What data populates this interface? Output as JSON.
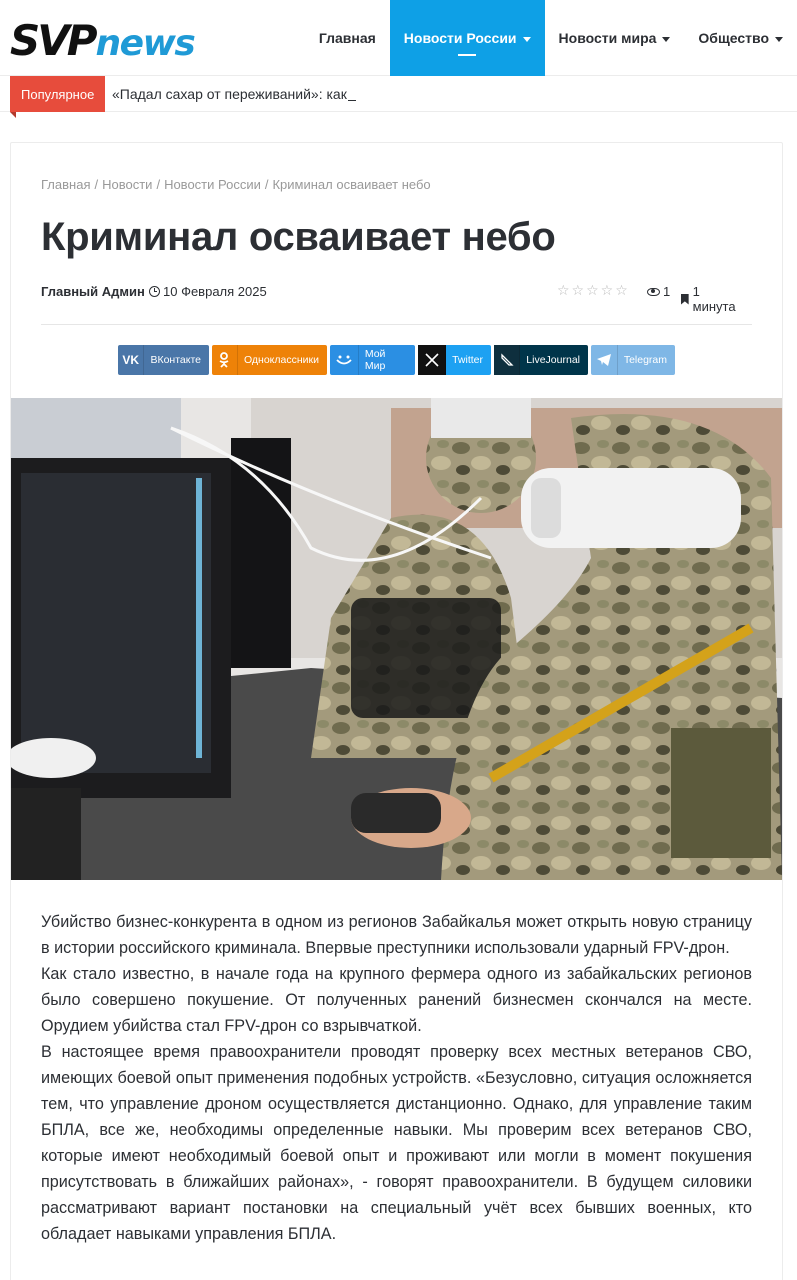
{
  "header": {
    "logo": {
      "part1": "SVP",
      "part2": "news"
    },
    "nav": [
      {
        "label": "Главная",
        "has_dropdown": false,
        "active": false
      },
      {
        "label": "Новости России",
        "has_dropdown": true,
        "active": true
      },
      {
        "label": "Новости мира",
        "has_dropdown": true,
        "active": false
      },
      {
        "label": "Общество",
        "has_dropdown": true,
        "active": false
      }
    ],
    "accent_color": "#0ea0e6"
  },
  "ticker": {
    "badge": "Популярное",
    "text": "«Падал сахар от переживаний»: как",
    "badge_color": "#e74c3c"
  },
  "article": {
    "breadcrumb": [
      "Главная",
      "Новости",
      "Новости России",
      "Криминал осваивает небо"
    ],
    "title": "Криминал осваивает небо",
    "author": "Главный Админ",
    "date": "10 Февраля 2025",
    "rating_stars": 0,
    "views": "1",
    "read_time": "1 минута",
    "share": [
      {
        "label": "ВКонтакте",
        "icon": "vk-icon",
        "color": "#4a76a8"
      },
      {
        "label": "Одноклассники",
        "icon": "ok-icon",
        "color": "#ee8208"
      },
      {
        "label": "Мой Мир",
        "icon": "mymir-icon",
        "color": "#2b8fe3"
      },
      {
        "label": "Twitter",
        "icon": "x-icon",
        "color": "#1da1f2"
      },
      {
        "label": "LiveJournal",
        "icon": "livejournal-icon",
        "color": "#00354a"
      },
      {
        "label": "Telegram",
        "icon": "telegram-icon",
        "color": "#7fb7e6"
      }
    ],
    "image": "photo of soldiers in camouflage with VR headsets operating drones at a computer",
    "paragraphs": [
      "Убийство бизнес-конкурента в одном из регионов Забайкалья может открыть новую страницу в истории российского криминала. Впервые преступники использовали ударный FPV-дрон.",
      "Как стало известно, в начале года на крупного фермера одного из забайкальских регионов было совершено покушение. От полученных ранений бизнесмен скончался на месте. Орудием убийства стал FPV-дрон со взрывчаткой.",
      "В настоящее время правоохранители проводят проверку всех местных ветеранов СВО, имеющих боевой опыт применения подобных устройств. «Безусловно, ситуация осложняется тем, что управление дроном осуществляется дистанционно. Однако, для управление таким БПЛА, все же, необходимы определенные навыки. Мы проверим всех ветеранов СВО, которые имеют необходимый боевой опыт и проживают или могли в момент покушения присутствовать в ближайших районах», - говорят правоохранители. В будущем силовики рассматривают вариант постановки на специальный учёт всех бывших военных, кто обладает навыками управления БПЛА."
    ]
  }
}
